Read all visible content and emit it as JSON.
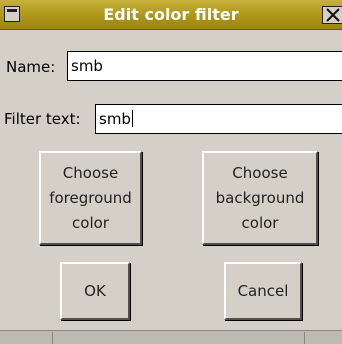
{
  "window": {
    "title": "Edit color filter"
  },
  "form": {
    "name_label": "Name:",
    "name_value": "smb",
    "filter_label": "Filter text:",
    "filter_value": "smb"
  },
  "buttons": {
    "foreground": "Choose\nforeground\ncolor",
    "background": "Choose\nbackground\ncolor",
    "ok": "OK",
    "cancel": "Cancel"
  },
  "icons": {
    "window_menu": "window-menu-icon",
    "close": "close-icon"
  },
  "colors": {
    "titlebar": "#b29a1c",
    "title_text": "#ffffff",
    "dialog_bg": "#d4d0c8"
  }
}
